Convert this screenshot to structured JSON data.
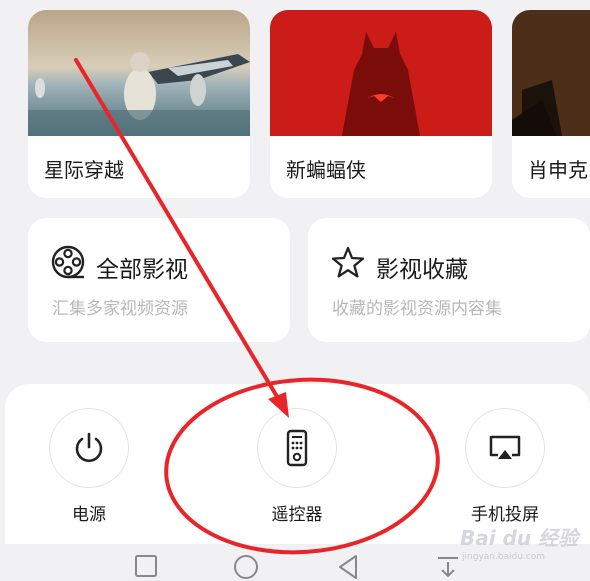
{
  "movies": [
    {
      "title": "星际穿越"
    },
    {
      "title": "新蝙蝠侠"
    },
    {
      "title": "肖申克"
    }
  ],
  "library": {
    "all": {
      "title": "全部影视",
      "subtitle": "汇集多家视频资源",
      "icon": "film-reel-icon"
    },
    "favorites": {
      "title": "影视收藏",
      "subtitle": "收藏的影视资源内容集",
      "icon": "star-icon"
    }
  },
  "actions": [
    {
      "label": "电源",
      "icon": "power-icon"
    },
    {
      "label": "遥控器",
      "icon": "remote-control-icon"
    },
    {
      "label": "手机投屏",
      "icon": "screen-cast-icon"
    }
  ],
  "watermark": {
    "brand": "Bai du 经验",
    "url": "jingyan.baidu.com"
  },
  "colors": {
    "annotation_red": "#e8262a",
    "background": "#f1f1f4",
    "card": "#ffffff"
  }
}
